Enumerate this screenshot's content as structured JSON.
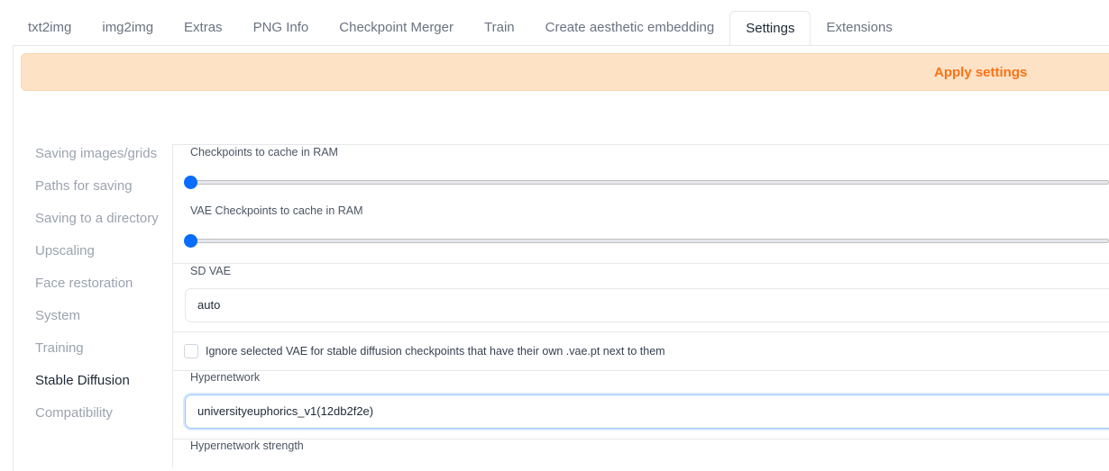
{
  "tabs": [
    {
      "label": "txt2img"
    },
    {
      "label": "img2img"
    },
    {
      "label": "Extras"
    },
    {
      "label": "PNG Info"
    },
    {
      "label": "Checkpoint Merger"
    },
    {
      "label": "Train"
    },
    {
      "label": "Create aesthetic embedding"
    },
    {
      "label": "Settings",
      "active": true
    },
    {
      "label": "Extensions"
    }
  ],
  "apply_label": "Apply settings",
  "sidebar": [
    "Saving images/grids",
    "Paths for saving",
    "Saving to a directory",
    "Upscaling",
    "Face restoration",
    "System",
    "Training",
    "Stable Diffusion",
    "Compatibility"
  ],
  "sidebar_selected": "Stable Diffusion",
  "settings": {
    "checkpoints_cache": {
      "label": "Checkpoints to cache in RAM",
      "value": 0
    },
    "vae_checkpoints_cache": {
      "label": "VAE Checkpoints to cache in RAM",
      "value": 0
    },
    "sd_vae": {
      "label": "SD VAE",
      "value": "auto"
    },
    "ignore_vae": {
      "label": "Ignore selected VAE for stable diffusion checkpoints that have their own .vae.pt next to them",
      "checked": false
    },
    "hypernetwork": {
      "label": "Hypernetwork",
      "value": "universityeuphorics_v1(12db2f2e)"
    },
    "hypernetwork_strength": {
      "label": "Hypernetwork strength"
    }
  },
  "colors": {
    "accent": "#0a6cff",
    "apply_bg": "#fde2c6",
    "apply_text": "#f97316"
  }
}
